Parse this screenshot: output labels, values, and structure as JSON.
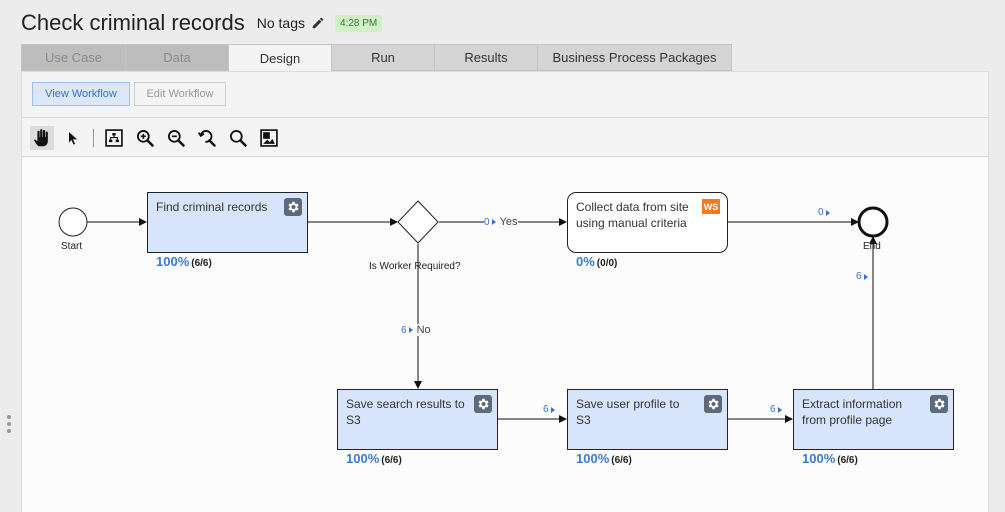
{
  "header": {
    "title": "Check criminal records",
    "tags": "No tags",
    "time": "4:28 PM"
  },
  "tabs": [
    {
      "label": "Use Case",
      "state": "disabled"
    },
    {
      "label": "Data",
      "state": "disabled"
    },
    {
      "label": "Design",
      "state": "active"
    },
    {
      "label": "Run",
      "state": "normal"
    },
    {
      "label": "Results",
      "state": "normal"
    },
    {
      "label": "Business Process Packages",
      "state": "normal"
    }
  ],
  "subtabs": {
    "view": "View Workflow",
    "edit": "Edit Workflow"
  },
  "toolbar": {
    "tools": [
      "hand-tool-icon",
      "pointer-tool-icon",
      "layout-icon",
      "zoom-in-icon",
      "zoom-out-icon",
      "zoom-reset-icon",
      "zoom-icon",
      "overview-icon"
    ]
  },
  "workflow": {
    "start_label": "Start",
    "end_label": "End",
    "gateway_label": "Is Worker Required?",
    "nodes": {
      "find": {
        "label": "Find criminal records",
        "pct": "100%",
        "count": "(6/6)"
      },
      "collect": {
        "label": "Collect data from site using manual criteria",
        "pct": "0%",
        "count": "(0/0)",
        "badge": "WS"
      },
      "save_search": {
        "label": "Save search results to S3",
        "pct": "100%",
        "count": "(6/6)"
      },
      "save_profile": {
        "label": "Save user profile to S3",
        "pct": "100%",
        "count": "(6/6)"
      },
      "extract": {
        "label": "Extract information from profile page",
        "pct": "100%",
        "count": "(6/6)"
      }
    },
    "edges": {
      "yes_count": "0",
      "yes_label": "Yes",
      "no_count": "6",
      "no_label": "No",
      "collect_end": "0",
      "search_profile": "6",
      "profile_extract": "6",
      "extract_end": "6"
    }
  },
  "colors": {
    "task_fill": "#d8e4fb",
    "percent": "#3a7bd5",
    "ws_badge": "#f37a21",
    "time_badge": "#d2f0c8"
  }
}
